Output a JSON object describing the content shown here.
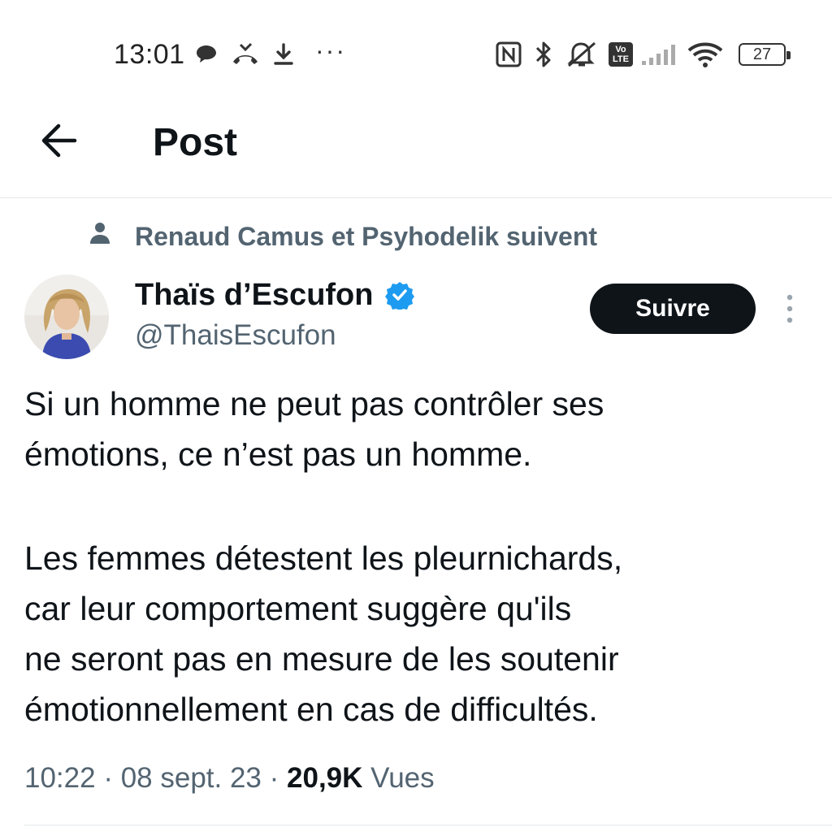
{
  "status_bar": {
    "time": "13:01",
    "more": "···",
    "volte_label": "Vo",
    "lte_label": "LTE",
    "battery": "27",
    "icons": [
      "chat-bubble-icon",
      "missed-call-icon",
      "download-icon",
      "nfc-icon",
      "bluetooth-icon",
      "mute-icon",
      "volte-icon",
      "signal-icon",
      "wifi-icon",
      "battery-icon"
    ]
  },
  "header": {
    "title": "Post",
    "back_icon": "arrow-left-icon"
  },
  "tweet": {
    "social_context": "Renaud Camus et Psyhodelik suivent",
    "author_name": "Thaïs d’Escufon",
    "author_handle": "@ThaisEscufon",
    "follow_label": "Suivre",
    "body_lines": [
      "Si un homme ne peut pas contrôler ses",
      "émotions, ce n’est pas un homme.",
      "Les femmes détestent les pleurnichards,",
      "car leur comportement suggère qu'ils",
      "ne seront pas en mesure de les soutenir",
      "émotionnellement en cas de difficultés."
    ],
    "time": "10:22",
    "separator": " · ",
    "date": "08 sept. 23",
    "views_count": "20,9K",
    "views_label": "Vues"
  },
  "colors": {
    "primary_text": "#0f1419",
    "secondary_text": "#536471",
    "verified_blue": "#1d9bf0",
    "divider": "#e3e7ea",
    "follow_bg": "#0f1419"
  }
}
